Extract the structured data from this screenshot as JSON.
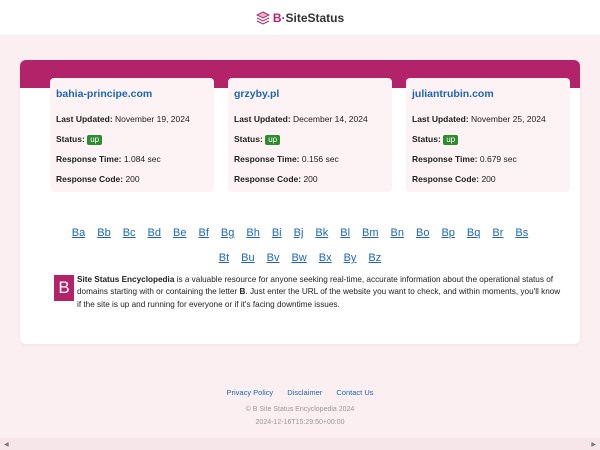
{
  "header": {
    "logo_prefix": "B",
    "logo_name": "SiteStatus",
    "logo_icon": "layered-box-icon",
    "accent_color": "#b3236a"
  },
  "sites": [
    {
      "domain": "bahia-principe.com",
      "last_updated_label": "Last Updated:",
      "last_updated": "November 19, 2024",
      "status_label": "Status:",
      "status": "up",
      "response_time_label": "Response Time:",
      "response_time": "1.084 sec",
      "response_code_label": "Response Code:",
      "response_code": "200"
    },
    {
      "domain": "grzyby.pl",
      "last_updated_label": "Last Updated:",
      "last_updated": "December 14, 2024",
      "status_label": "Status:",
      "status": "up",
      "response_time_label": "Response Time:",
      "response_time": "0.156 sec",
      "response_code_label": "Response Code:",
      "response_code": "200"
    },
    {
      "domain": "juliantrubin.com",
      "last_updated_label": "Last Updated:",
      "last_updated": "November 25, 2024",
      "status_label": "Status:",
      "status": "up",
      "response_time_label": "Response Time:",
      "response_time": "0.679 sec",
      "response_code_label": "Response Code:",
      "response_code": "200"
    }
  ],
  "letters_row1": [
    "Ba",
    "Bb",
    "Bc",
    "Bd",
    "Be",
    "Bf",
    "Bg",
    "Bh",
    "Bi",
    "Bj",
    "Bk",
    "Bl",
    "Bm",
    "Bn",
    "Bo",
    "Bp",
    "Bq",
    "Br",
    "Bs"
  ],
  "letters_row2": [
    "Bt",
    "Bu",
    "Bv",
    "Bw",
    "Bx",
    "By",
    "Bz"
  ],
  "description": {
    "dropcap": "B",
    "title": "Site Status Encyclopedia",
    "text_part1": " is a valuable resource for anyone seeking real-time, accurate information about the operational status of domains starting with or containing the letter ",
    "letter": "B",
    "text_part2": ". Just enter the URL of the website you want to check, and within moments, you'll know if the site is up and running for everyone or if it's facing downtime issues."
  },
  "footer": {
    "links": [
      "Privacy Policy",
      "Disclaimer",
      "Contact Us"
    ],
    "copyright": "© B Site Status Encyclopedia 2024",
    "timestamp": "2024-12-16T15:29:50+00:00"
  }
}
